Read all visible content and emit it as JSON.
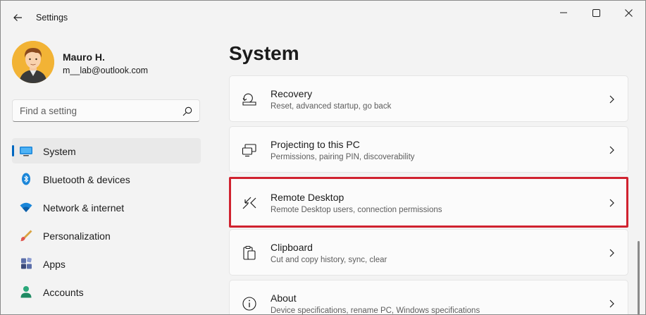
{
  "window": {
    "title": "Settings"
  },
  "profile": {
    "name": "Mauro H.",
    "email": "m__lab@outlook.com"
  },
  "search": {
    "placeholder": "Find a setting"
  },
  "nav": {
    "items": [
      {
        "label": "System",
        "icon": "system-icon",
        "selected": true
      },
      {
        "label": "Bluetooth & devices",
        "icon": "bluetooth-icon"
      },
      {
        "label": "Network & internet",
        "icon": "wifi-icon"
      },
      {
        "label": "Personalization",
        "icon": "paintbrush-icon"
      },
      {
        "label": "Apps",
        "icon": "apps-icon"
      },
      {
        "label": "Accounts",
        "icon": "person-icon"
      }
    ]
  },
  "main": {
    "title": "System",
    "cards": [
      {
        "title": "Recovery",
        "description": "Reset, advanced startup, go back",
        "icon": "recovery-icon"
      },
      {
        "title": "Projecting to this PC",
        "description": "Permissions, pairing PIN, discoverability",
        "icon": "projecting-icon"
      },
      {
        "title": "Remote Desktop",
        "description": "Remote Desktop users, connection permissions",
        "icon": "remote-desktop-icon",
        "highlighted": true
      },
      {
        "title": "Clipboard",
        "description": "Cut and copy history, sync, clear",
        "icon": "clipboard-icon"
      },
      {
        "title": "About",
        "description": "Device specifications, rename PC, Windows specifications",
        "icon": "info-icon"
      }
    ]
  },
  "colors": {
    "accent": "#0067c0",
    "highlight": "#d0222f",
    "background": "#f3f3f3"
  }
}
